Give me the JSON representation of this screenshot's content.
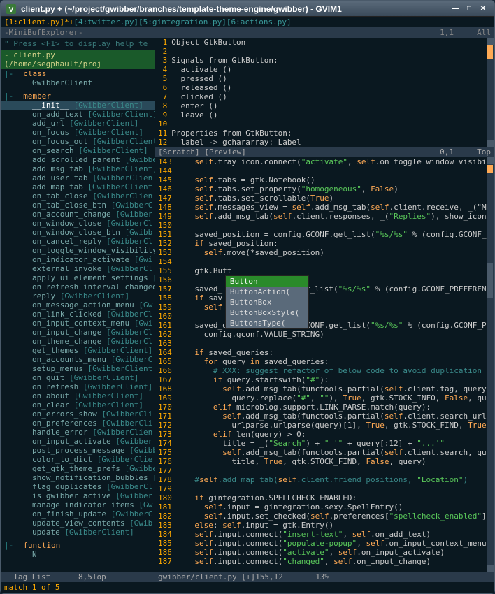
{
  "window": {
    "title": "client.py + (~/project/gwibber/branches/template-theme-engine/gwibber) - GVIM1"
  },
  "buffers": {
    "active": "[1:client.py]*+",
    "others": "[4:twitter.py][5:gintegration.py][6:actions.py]"
  },
  "minibuf": {
    "label": "-MiniBufExplorer-",
    "pos": "1,1",
    "right": "All"
  },
  "hint": "\" Press <F1> to display help te",
  "file_header": "client.py (/home/segphault/proj",
  "tags": {
    "class_kind": "class",
    "class_name": "GwibberClient",
    "member_kind": "member",
    "function_kind": "function",
    "function_name": "N",
    "members": [
      {
        "fn": "__init__",
        "cls": "[GwibberClient]",
        "sel": true
      },
      {
        "fn": "on_add_text",
        "cls": "[GwibberClient]"
      },
      {
        "fn": "add_url",
        "cls": "[GwibberClient]"
      },
      {
        "fn": "on_focus",
        "cls": "[GwibberClient]"
      },
      {
        "fn": "on_focus_out",
        "cls": "[GwibberClient]"
      },
      {
        "fn": "on_search",
        "cls": "[GwibberClient]"
      },
      {
        "fn": "add_scrolled_parent",
        "cls": "[Gwibbe"
      },
      {
        "fn": "add_msg_tab",
        "cls": "[GwibberClient]"
      },
      {
        "fn": "add_user_tab",
        "cls": "[GwibberClien"
      },
      {
        "fn": "add_map_tab",
        "cls": "[GwibberClient"
      },
      {
        "fn": "on_tab_close",
        "cls": "[GwibberClien"
      },
      {
        "fn": "on_tab_close_btn",
        "cls": "[GwibberC"
      },
      {
        "fn": "on_account_change",
        "cls": "[Gwibber"
      },
      {
        "fn": "on_window_close",
        "cls": "[GwibberCl"
      },
      {
        "fn": "on_window_close_btn",
        "cls": "[Gwibb"
      },
      {
        "fn": "on_cancel_reply",
        "cls": "[GwibberCl"
      },
      {
        "fn": "on_toggle_window_visibility",
        "cls": ""
      },
      {
        "fn": "on_indicator_activate",
        "cls": "[Gwi"
      },
      {
        "fn": "external_invoke",
        "cls": "[GwibberCl"
      },
      {
        "fn": "apply_ui_element_settings",
        "cls": "["
      },
      {
        "fn": "on_refresh_interval_changed",
        "cls": ""
      },
      {
        "fn": "reply",
        "cls": "[GwibberClient]"
      },
      {
        "fn": "on_message_action_menu",
        "cls": "[Gw"
      },
      {
        "fn": "on_link_clicked",
        "cls": "[GwibberCl"
      },
      {
        "fn": "on_input_context_menu",
        "cls": "[Gwi"
      },
      {
        "fn": "on_input_change",
        "cls": "[GwibberCl"
      },
      {
        "fn": "on_theme_change",
        "cls": "[GwibberCl"
      },
      {
        "fn": "get_themes",
        "cls": "[GwibberClient]"
      },
      {
        "fn": "on_accounts_menu",
        "cls": "[GwibberC"
      },
      {
        "fn": "setup_menus",
        "cls": "[GwibberClient"
      },
      {
        "fn": "on_quit",
        "cls": "[GwibberClient]"
      },
      {
        "fn": "on_refresh",
        "cls": "[GwibberClient]"
      },
      {
        "fn": "on_about",
        "cls": "[GwibberClient]"
      },
      {
        "fn": "on_clear",
        "cls": "[GwibberClient]"
      },
      {
        "fn": "on_errors_show",
        "cls": "[GwibberCli"
      },
      {
        "fn": "on_preferences",
        "cls": "[GwibberCli"
      },
      {
        "fn": "handle_error",
        "cls": "[GwibberClien"
      },
      {
        "fn": "on_input_activate",
        "cls": "[Gwibber"
      },
      {
        "fn": "post_process_message",
        "cls": "[Gwibb"
      },
      {
        "fn": "color_to_dict",
        "cls": "[GwibberClie"
      },
      {
        "fn": "get_gtk_theme_prefs",
        "cls": "[Gwibbe"
      },
      {
        "fn": "show_notification_bubbles",
        "cls": "["
      },
      {
        "fn": "flag_duplicates",
        "cls": "[GwibberCl"
      },
      {
        "fn": "is_gwibber_active",
        "cls": "[Gwibber"
      },
      {
        "fn": "manage_indicator_items",
        "cls": "[Gw"
      },
      {
        "fn": "on_finish_update",
        "cls": "[GwibberC"
      },
      {
        "fn": "update_view_contents",
        "cls": "[Gwib"
      },
      {
        "fn": "update",
        "cls": "[GwibberClient]"
      }
    ]
  },
  "top_code": {
    "lines": [
      {
        "n": "1",
        "t": "Object GtkButton"
      },
      {
        "n": "2",
        "t": ""
      },
      {
        "n": "3",
        "t": "Signals from GtkButton:"
      },
      {
        "n": "4",
        "t": "  activate ()"
      },
      {
        "n": "5",
        "t": "  pressed ()"
      },
      {
        "n": "6",
        "t": "  released ()"
      },
      {
        "n": "7",
        "t": "  clicked ()"
      },
      {
        "n": "8",
        "t": "  enter ()"
      },
      {
        "n": "9",
        "t": "  leave ()"
      },
      {
        "n": "10",
        "t": ""
      },
      {
        "n": "11",
        "t": "Properties from GtkButton:"
      },
      {
        "n": "12",
        "t": "  label -> gchararray: Label"
      }
    ]
  },
  "scratch_bar": {
    "left": "[Scratch] [Preview]",
    "pos": "0,1",
    "right": "Top"
  },
  "completion": {
    "items": [
      "Button",
      "ButtonAction(",
      "ButtonBox",
      "ButtonBoxStyle(",
      "ButtonsType("
    ],
    "selected": 0
  },
  "main_code": {
    "start": 143,
    "lines": [
      "    self.tray_icon.connect(\"activate\", self.on_toggle_window_visibility",
      "",
      "    self.tabs = gtk.Notebook()",
      "    self.tabs.set_property(\"homogeneous\", False)",
      "    self.tabs.set_scrollable(True)",
      "    self.messages_view = self.add_msg_tab(self.client.receive, _(\"Messa",
      "    self.add_msg_tab(self.client.responses, _(\"Replies\"), show_icon = \"",
      "",
      "    saved_position = config.GCONF.get_list(\"%s/%s\" % (config.GCONF_PREF",
      "    if saved_position:",
      "      self.move(*saved_position)",
      "",
      "    gtk.Butt",
      "",
      "    saved_             NF.get_list(\"%s/%s\" % (config.GCONF_PREFEREN",
      "    if sav",
      "      self            ze)",
      "",
      "    saved_queries = config.GCONF.get_list(\"%s/%s\" % (config.GCONF_PREFE",
      "      config.gconf.VALUE_STRING)",
      "",
      "    if saved_queries:",
      "      for query in saved_queries:",
      "        # XXX: suggest refactor of below code to avoid duplication of o",
      "        if query.startswith(\"#\"):",
      "          self.add_msg_tab(functools.partial(self.client.tag, query),",
      "            query.replace(\"#\", \"\"), True, gtk.STOCK_INFO, False, query)",
      "        elif microblog.support.LINK_PARSE.match(query):",
      "          self.add_msg_tab(functools.partial(self.client.search_url, qu",
      "            urlparse.urlparse(query)[1], True, gtk.STOCK_FIND, True, qu",
      "        elif len(query) > 0:",
      "          title = _(\"Search\") + \" '\" + query[:12] + \"...'\"",
      "          self.add_msg_tab(functools.partial(self.client.search, query)",
      "            title, True, gtk.STOCK_FIND, False, query)",
      "",
      "    #self.add_map_tab(self.client.friend_positions, \"Location\")",
      "",
      "    if gintegration.SPELLCHECK_ENABLED:",
      "      self.input = gintegration.sexy.SpellEntry()",
      "      self.input.set_checked(self.preferences[\"spellcheck_enabled\"])",
      "    else: self.input = gtk.Entry()",
      "    self.input.connect(\"insert-text\", self.on_add_text)",
      "    self.input.connect(\"populate-popup\", self.on_input_context_menu)",
      "    self.input.connect(\"activate\", self.on_input_activate)",
      "    self.input.connect(\"changed\", self.on_input_change)"
    ]
  },
  "tag_status": {
    "left": "__Tag_List__",
    "pos": "8,5",
    "right": "Top"
  },
  "main_status": {
    "file": "gwibber/client.py [+]",
    "pos": "155,12",
    "pct": "13%"
  },
  "cmdline": "match 1 of 5"
}
